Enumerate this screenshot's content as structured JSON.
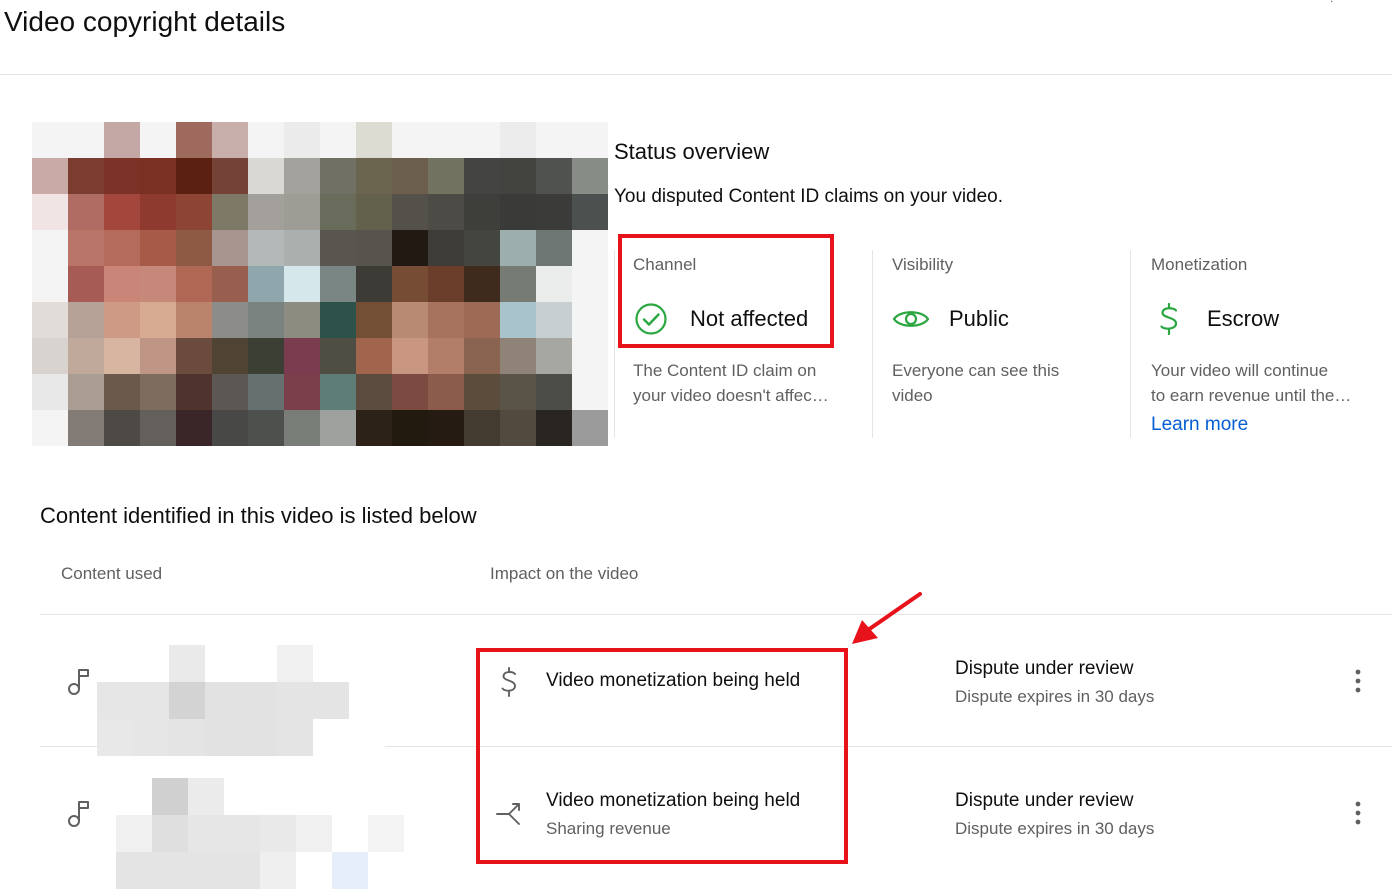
{
  "page": {
    "title": "Video copyright details"
  },
  "status": {
    "title": "Status overview",
    "description": "You disputed Content ID claims on your video.",
    "cards": [
      {
        "label": "Channel",
        "value": "Not affected",
        "note_line1": "The Content ID claim on",
        "note_line2": "your video doesn't affec…",
        "icon": "check-circle-icon"
      },
      {
        "label": "Visibility",
        "value": "Public",
        "note_line1": "Everyone can see this",
        "note_line2": "video",
        "icon": "eye-icon"
      },
      {
        "label": "Monetization",
        "value": "Escrow",
        "note_line1": "Your video will continue",
        "note_line2": "to earn revenue until the…",
        "link": "Learn more",
        "icon": "dollar-icon"
      }
    ]
  },
  "content": {
    "title": "Content identified in this video is listed below",
    "headers": {
      "content_used": "Content used",
      "impact": "Impact on the video"
    },
    "rows": [
      {
        "icon": "music-note-icon",
        "impact_icon": "dollar-icon",
        "impact": "Video monetization being held",
        "impact_sub": "",
        "status": "Dispute under review",
        "status_sub": "Dispute expires in 30 days"
      },
      {
        "icon": "music-note-icon",
        "impact_icon": "split-arrow-icon",
        "impact": "Video monetization being held",
        "impact_sub": "Sharing revenue",
        "status": "Dispute under review",
        "status_sub": "Dispute expires in 30 days"
      }
    ]
  },
  "colors": {
    "accent_red": "#e8131a",
    "success_green": "#2ba640",
    "link_blue": "#065fd4"
  },
  "thumbnail": {
    "colors": [
      [
        "#f4f4f4",
        "#f4f4f4",
        "#c4a8a5",
        "#f4f4f4",
        "#9e6a5d",
        "#c9afac",
        "#f4f4f4",
        "#ebebeb",
        "#f4f4f4",
        "#dcdcd3",
        "#f4f4f4",
        "#f4f4f4",
        "#f4f4f4",
        "#ececec",
        "#f4f4f4",
        "#f4f4f4"
      ],
      [
        "#c9aaa6",
        "#7b3d30",
        "#7c3327",
        "#7a3124",
        "#5c2010",
        "#744236",
        "#d9d8d5",
        "#a4a29d",
        "#707064",
        "#6b654f",
        "#6c5e4c",
        "#727261",
        "#444542",
        "#434340",
        "#4f524e",
        "#888c86"
      ],
      [
        "#f0e4e4",
        "#b06b63",
        "#a3473c",
        "#8e3a2e",
        "#8d4434",
        "#7e7866",
        "#a3a09c",
        "#9d9d95",
        "#696b5b",
        "#63604c",
        "#54504a",
        "#4c4b45",
        "#3e3e3b",
        "#3a3a38",
        "#3b3c3a",
        "#4c504f"
      ],
      [
        "#f4f4f4",
        "#b97568",
        "#b56c5c",
        "#a85a48",
        "#8f5a44",
        "#a99590",
        "#b3b9b9",
        "#aab0ae",
        "#59564f",
        "#57544d",
        "#221a12",
        "#3d3c36",
        "#454540",
        "#9cafac",
        "#6e7774",
        "#f4f4f4"
      ],
      [
        "#f4f4f4",
        "#a65b54",
        "#c98578",
        "#c68878",
        "#b06854",
        "#985f4e",
        "#8ea6ac",
        "#d5e7ea",
        "#798683",
        "#3d3b35",
        "#764c34",
        "#6a3e2b",
        "#3f2b1d",
        "#767b74",
        "#eaedeb",
        "#f4f4f4"
      ],
      [
        "#e2dcd8",
        "#b7a297",
        "#cf9a85",
        "#d7aa92",
        "#b9836c",
        "#8c8c8b",
        "#7b8381",
        "#8c8d80",
        "#2c5249",
        "#734f35",
        "#b98a73",
        "#a7725e",
        "#9d6a56",
        "#a9c3cc",
        "#c8cfd1",
        "#f4f4f4"
      ],
      [
        "#d9d3cf",
        "#c0a99a",
        "#d7b5a1",
        "#bf9686",
        "#6b4b3e",
        "#4f4334",
        "#3c3f34",
        "#7c3c50",
        "#4e4e45",
        "#a1654d",
        "#c99682",
        "#b27e6a",
        "#8b6451",
        "#8f8377",
        "#a6a7a0",
        "#f4f4f4"
      ],
      [
        "#e8e8e8",
        "#a99d94",
        "#6b5a4c",
        "#7e6d5e",
        "#4e342d",
        "#5d5753",
        "#66706e",
        "#7b3e4b",
        "#5f7d77",
        "#5b4c3f",
        "#7c4a41",
        "#8b5c4c",
        "#5c4c3c",
        "#5a5448",
        "#4c4c49",
        "#f4f4f4"
      ],
      [
        "#f4f4f4",
        "#837c76",
        "#4d4945",
        "#635f5b",
        "#3a2529",
        "#484847",
        "#4d504c",
        "#797d78",
        "#9fa19e",
        "#2d2218",
        "#22190f",
        "#261b13",
        "#433b2f",
        "#524a3f",
        "#292621",
        "#9b9b9b"
      ],
      [
        "#f4f4f4",
        "#f0f0f0",
        "#f4f4f4",
        "#777777",
        "#bdbdbd",
        "#e3e3e3",
        "#f4f4f4",
        "#f4f4f4",
        "#dfdfdf",
        "#f4f4f4",
        "#a0a0a0",
        "#f4f4f4",
        "#f4f4f4",
        "#f4f4f4",
        "#d6d6d6",
        "#f4f4f4"
      ]
    ]
  },
  "blur_rows": [
    [
      [
        "#ffffff",
        "#ffffff",
        "#eaeaea",
        "#ffffff",
        "#ffffff",
        "#f0f0f0",
        "#ffffff",
        "#ffffff"
      ],
      [
        "#e6e6e6",
        "#e6e6e6",
        "#d3d3d3",
        "#e2e2e2",
        "#e2e2e2",
        "#e4e4e4",
        "#e4e4e4",
        "#ffffff"
      ],
      [
        "#e8e8e8",
        "#e6e6e6",
        "#e4e4e4",
        "#e2e2e2",
        "#e2e2e2",
        "#e4e4e4",
        "#ffffff",
        "#ffffff"
      ]
    ],
    [
      [
        "#ffffff",
        "#d0d0d0",
        "#ebebeb",
        "#ffffff",
        "#ffffff",
        "#ffffff",
        "#ffffff",
        "#ffffff"
      ],
      [
        "#f0f0f0",
        "#dfdfdf",
        "#e6e6e6",
        "#e6e6e6",
        "#e9e9e9",
        "#f0f0f0",
        "#ffffff",
        "#f4f4f4"
      ],
      [
        "#e4e4e4",
        "#e4e4e4",
        "#e4e4e4",
        "#e4e4e4",
        "#efefef",
        "#ffffff",
        "#e6eef9",
        "#ffffff"
      ]
    ]
  ]
}
